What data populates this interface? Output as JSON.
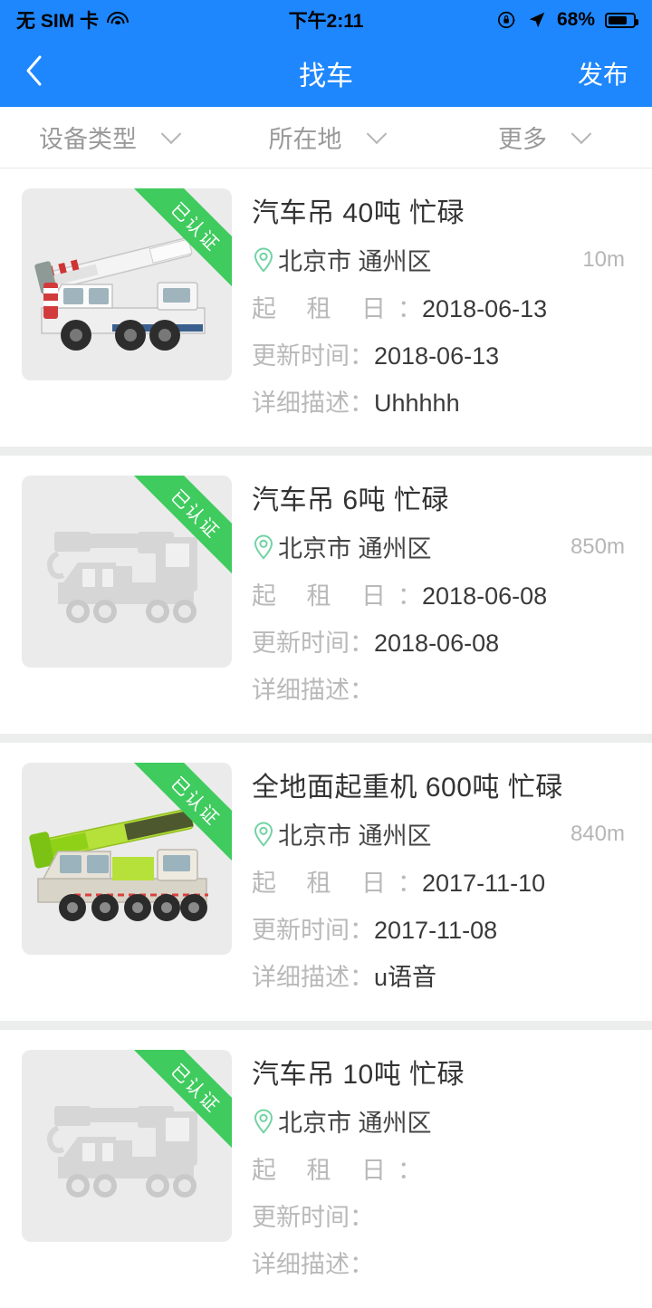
{
  "status_bar": {
    "carrier": "无 SIM 卡",
    "wifi_icon": "wifi-icon",
    "time": "下午2:11",
    "rotation_lock_icon": "rotation-lock-icon",
    "location_icon": "location-arrow-icon",
    "battery_percent": "68%",
    "battery_level": 68
  },
  "nav": {
    "back_icon": "chevron-left-icon",
    "title": "找车",
    "action_label": "发布",
    "background_color": "#1f87fd"
  },
  "filters": [
    {
      "label": "设备类型",
      "icon": "chevron-down-icon"
    },
    {
      "label": "所在地",
      "icon": "chevron-down-icon"
    },
    {
      "label": "更多",
      "icon": "chevron-down-icon"
    }
  ],
  "labels": {
    "rent_date": "起 租 日",
    "update_time": "更新时间",
    "description": "详细描述",
    "colon": "："
  },
  "badge": {
    "verified_text": "已认证",
    "color": "#3fcb5e"
  },
  "listings": [
    {
      "title": "汽车吊 40吨 忙碌",
      "location": "北京市 通州区",
      "distance": "10m",
      "rent_date": "2018-06-13",
      "update_time": "2018-06-13",
      "description": "Uhhhhh",
      "verified": "已认证",
      "image_type": "photo-white-crane"
    },
    {
      "title": "汽车吊 6吨 忙碌",
      "location": "北京市 通州区",
      "distance": "850m",
      "rent_date": "2018-06-08",
      "update_time": "2018-06-08",
      "description": "",
      "verified": "已认证",
      "image_type": "placeholder-crane"
    },
    {
      "title": "全地面起重机 600吨 忙碌",
      "location": "北京市 通州区",
      "distance": "840m",
      "rent_date": "2017-11-10",
      "update_time": "2017-11-08",
      "description": "u语音",
      "verified": "已认证",
      "image_type": "photo-green-crane"
    },
    {
      "title": "汽车吊 10吨 忙碌",
      "location": "北京市 通州区",
      "distance": "",
      "rent_date": "",
      "update_time": "",
      "description": "",
      "verified": "已认证",
      "image_type": "placeholder-crane"
    }
  ]
}
